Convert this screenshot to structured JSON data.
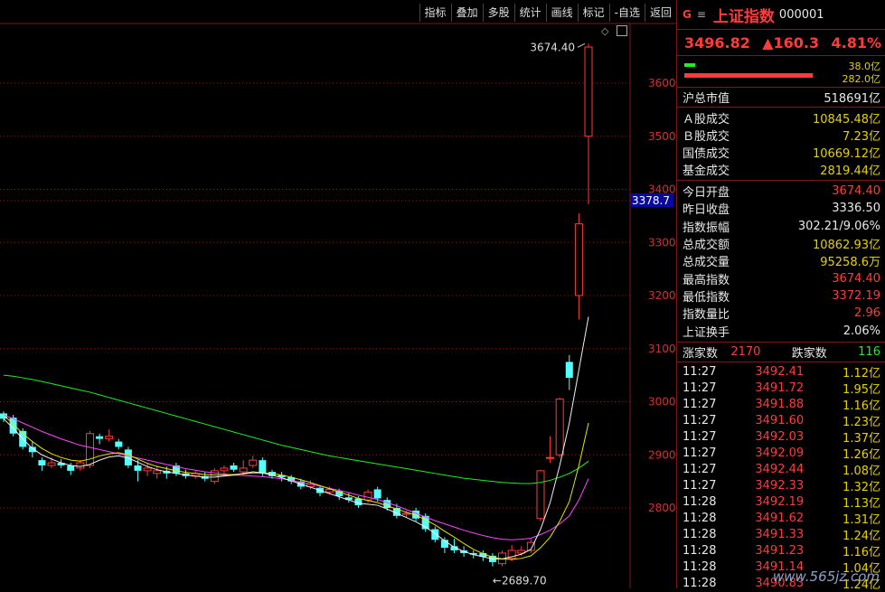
{
  "toolbar": [
    "指标",
    "叠加",
    "多股",
    "统计",
    "画线",
    "标记",
    "-自选",
    "返回"
  ],
  "chart_data": {
    "type": "candlestick",
    "y_ticks": [
      2800,
      2900,
      3000,
      3100,
      3200,
      3300,
      3400,
      3500,
      3600
    ],
    "y_tick_labels": [
      "2800",
      "2900",
      "3000",
      "3100",
      "3200",
      "3300",
      "3400",
      "3500",
      "3600"
    ],
    "price_marker": "3378.7",
    "high_annotation": "3674.40",
    "low_annotation": "2689.70",
    "candles": [
      [
        2978,
        2968,
        2982,
        2962
      ],
      [
        2970,
        2940,
        2975,
        2935
      ],
      [
        2945,
        2915,
        2950,
        2910
      ],
      [
        2915,
        2905,
        2925,
        2895
      ],
      [
        2890,
        2880,
        2895,
        2870
      ],
      [
        2880,
        2885,
        2895,
        2875
      ],
      [
        2885,
        2880,
        2892,
        2875
      ],
      [
        2880,
        2870,
        2885,
        2862
      ],
      [
        2875,
        2885,
        2890,
        2870
      ],
      [
        2880,
        2940,
        2945,
        2875
      ],
      [
        2935,
        2930,
        2940,
        2920
      ],
      [
        2930,
        2935,
        2948,
        2925
      ],
      [
        2925,
        2915,
        2930,
        2910
      ],
      [
        2910,
        2880,
        2915,
        2875
      ],
      [
        2880,
        2870,
        2890,
        2850
      ],
      [
        2870,
        2875,
        2885,
        2860
      ],
      [
        2865,
        2870,
        2880,
        2855
      ],
      [
        2870,
        2865,
        2878,
        2855
      ],
      [
        2880,
        2865,
        2885,
        2860
      ],
      [
        2865,
        2860,
        2872,
        2855
      ],
      [
        2860,
        2865,
        2870,
        2855
      ],
      [
        2860,
        2855,
        2868,
        2850
      ],
      [
        2850,
        2870,
        2875,
        2845
      ],
      [
        2870,
        2875,
        2880,
        2860
      ],
      [
        2880,
        2872,
        2885,
        2868
      ],
      [
        2868,
        2875,
        2890,
        2862
      ],
      [
        2880,
        2890,
        2898,
        2875
      ],
      [
        2890,
        2865,
        2895,
        2860
      ],
      [
        2868,
        2860,
        2872,
        2855
      ],
      [
        2862,
        2858,
        2868,
        2850
      ],
      [
        2858,
        2850,
        2862,
        2845
      ],
      [
        2850,
        2840,
        2855,
        2835
      ],
      [
        2840,
        2845,
        2852,
        2835
      ],
      [
        2838,
        2828,
        2842,
        2822
      ],
      [
        2830,
        2835,
        2840,
        2825
      ],
      [
        2832,
        2822,
        2836,
        2815
      ],
      [
        2820,
        2815,
        2828,
        2810
      ],
      [
        2818,
        2805,
        2822,
        2800
      ],
      [
        2815,
        2830,
        2835,
        2810
      ],
      [
        2835,
        2818,
        2840,
        2812
      ],
      [
        2815,
        2800,
        2820,
        2795
      ],
      [
        2800,
        2785,
        2808,
        2780
      ],
      [
        2788,
        2790,
        2795,
        2782
      ],
      [
        2795,
        2780,
        2800,
        2775
      ],
      [
        2785,
        2760,
        2790,
        2755
      ],
      [
        2760,
        2740,
        2765,
        2735
      ],
      [
        2740,
        2725,
        2745,
        2715
      ],
      [
        2728,
        2720,
        2742,
        2715
      ],
      [
        2720,
        2715,
        2728,
        2708
      ],
      [
        2715,
        2712,
        2720,
        2705
      ],
      [
        2715,
        2708,
        2720,
        2700
      ],
      [
        2710,
        2698,
        2715,
        2690
      ],
      [
        2695,
        2715,
        2720,
        2690
      ],
      [
        2705,
        2720,
        2730,
        2700
      ],
      [
        2715,
        2720,
        2728,
        2710
      ],
      [
        2720,
        2735,
        2742,
        2715
      ],
      [
        2780,
        2870,
        2872,
        2775
      ],
      [
        2895,
        2895,
        2935,
        2885
      ],
      [
        2900,
        3005,
        3008,
        2895
      ],
      [
        3075,
        3045,
        3088,
        3022
      ],
      [
        3200,
        3335,
        3355,
        3155
      ],
      [
        3500,
        3668,
        3674,
        3372
      ]
    ],
    "ma_yellow": [
      2975,
      2958,
      2940,
      2925,
      2912,
      2902,
      2895,
      2890,
      2888,
      2892,
      2898,
      2902,
      2904,
      2900,
      2892,
      2884,
      2878,
      2874,
      2870,
      2867,
      2865,
      2863,
      2862,
      2862,
      2863,
      2864,
      2866,
      2866,
      2865,
      2862,
      2858,
      2853,
      2848,
      2842,
      2836,
      2830,
      2824,
      2818,
      2814,
      2810,
      2804,
      2798,
      2792,
      2786,
      2778,
      2768,
      2756,
      2745,
      2733,
      2722,
      2714,
      2707,
      2704,
      2703,
      2705,
      2710,
      2725,
      2745,
      2775,
      2812,
      2880,
      2960
    ],
    "ma_white": [
      2968,
      2950,
      2930,
      2912,
      2900,
      2892,
      2885,
      2880,
      2878,
      2882,
      2890,
      2896,
      2898,
      2894,
      2886,
      2878,
      2872,
      2868,
      2865,
      2862,
      2860,
      2858,
      2858,
      2860,
      2862,
      2865,
      2868,
      2866,
      2862,
      2857,
      2851,
      2845,
      2839,
      2833,
      2827,
      2821,
      2815,
      2809,
      2807,
      2805,
      2798,
      2790,
      2782,
      2774,
      2764,
      2752,
      2738,
      2726,
      2718,
      2712,
      2708,
      2704,
      2704,
      2708,
      2713,
      2722,
      2760,
      2810,
      2880,
      2960,
      3060,
      3160
    ],
    "ma_magenta": [
      2975,
      2968,
      2960,
      2952,
      2944,
      2937,
      2930,
      2924,
      2918,
      2914,
      2910,
      2906,
      2902,
      2898,
      2894,
      2890,
      2886,
      2882,
      2878,
      2874,
      2871,
      2868,
      2866,
      2864,
      2862,
      2861,
      2860,
      2859,
      2857,
      2855,
      2852,
      2848,
      2845,
      2841,
      2837,
      2833,
      2829,
      2824,
      2820,
      2816,
      2810,
      2804,
      2797,
      2790,
      2783,
      2776,
      2770,
      2764,
      2758,
      2753,
      2748,
      2744,
      2741,
      2740,
      2741,
      2743,
      2750,
      2758,
      2770,
      2785,
      2815,
      2855
    ],
    "ma_green": [
      3050,
      3048,
      3045,
      3042,
      3038,
      3034,
      3030,
      3026,
      3022,
      3018,
      3013,
      3008,
      3003,
      2998,
      2993,
      2988,
      2983,
      2978,
      2973,
      2968,
      2963,
      2958,
      2953,
      2948,
      2943,
      2938,
      2933,
      2928,
      2923,
      2918,
      2914,
      2910,
      2906,
      2902,
      2898,
      2895,
      2892,
      2889,
      2886,
      2883,
      2880,
      2877,
      2874,
      2871,
      2868,
      2865,
      2862,
      2859,
      2856,
      2854,
      2852,
      2850,
      2848,
      2847,
      2846,
      2846,
      2848,
      2852,
      2858,
      2865,
      2875,
      2888
    ]
  },
  "panel": {
    "g_label": "G",
    "menu_label": "≡",
    "index_name": "上证指数",
    "index_code": "000001",
    "price": "3496.82",
    "change": "▲160.3",
    "change_pct": "4.81%",
    "bar_top_value": "38.0亿",
    "bar_bottom_value": "282.0亿",
    "market_cap_label": "沪总市值",
    "market_cap_value": "518691亿",
    "turnover": [
      {
        "label": "Ａ股成交",
        "value": "10845.48亿"
      },
      {
        "label": "Ｂ股成交",
        "value": "7.23亿"
      },
      {
        "label": "国债成交",
        "value": "10669.12亿"
      },
      {
        "label": "基金成交",
        "value": "2819.44亿"
      }
    ],
    "stats": [
      {
        "label": "今日开盘",
        "value": "3674.40",
        "color": "red"
      },
      {
        "label": "昨日收盘",
        "value": "3336.50",
        "color": "white"
      },
      {
        "label": "指数振幅",
        "value": "302.21/9.06%",
        "color": "white"
      },
      {
        "label": "总成交额",
        "value": "10862.93亿",
        "color": "yellow"
      },
      {
        "label": "总成交量",
        "value": "95258.6万",
        "color": "yellow"
      },
      {
        "label": "最高指数",
        "value": "3674.40",
        "color": "red"
      },
      {
        "label": "最低指数",
        "value": "3372.19",
        "color": "red"
      },
      {
        "label": "指数量比",
        "value": "2.96",
        "color": "red"
      },
      {
        "label": "上证换手",
        "value": "2.06%",
        "color": "white"
      }
    ],
    "up_label": "涨家数",
    "up_count": "2170",
    "down_label": "跌家数",
    "down_count": "116",
    "trades": [
      {
        "time": "11:27",
        "price": "3492.41",
        "amount": "1.12亿"
      },
      {
        "time": "11:27",
        "price": "3491.72",
        "amount": "1.95亿"
      },
      {
        "time": "11:27",
        "price": "3491.88",
        "amount": "1.16亿"
      },
      {
        "time": "11:27",
        "price": "3491.60",
        "amount": "1.23亿"
      },
      {
        "time": "11:27",
        "price": "3492.03",
        "amount": "1.37亿"
      },
      {
        "time": "11:27",
        "price": "3492.09",
        "amount": "1.26亿"
      },
      {
        "time": "11:27",
        "price": "3492.44",
        "amount": "1.08亿"
      },
      {
        "time": "11:27",
        "price": "3492.33",
        "amount": "1.32亿"
      },
      {
        "time": "11:28",
        "price": "3492.19",
        "amount": "1.13亿"
      },
      {
        "time": "11:28",
        "price": "3491.62",
        "amount": "1.31亿"
      },
      {
        "time": "11:28",
        "price": "3491.33",
        "amount": "1.24亿"
      },
      {
        "time": "11:28",
        "price": "3491.23",
        "amount": "1.16亿"
      },
      {
        "time": "11:28",
        "price": "3491.14",
        "amount": "1.04亿"
      },
      {
        "time": "11:28",
        "price": "3490.83",
        "amount": "1.24亿"
      }
    ],
    "watermark": "www.565jz.com"
  }
}
